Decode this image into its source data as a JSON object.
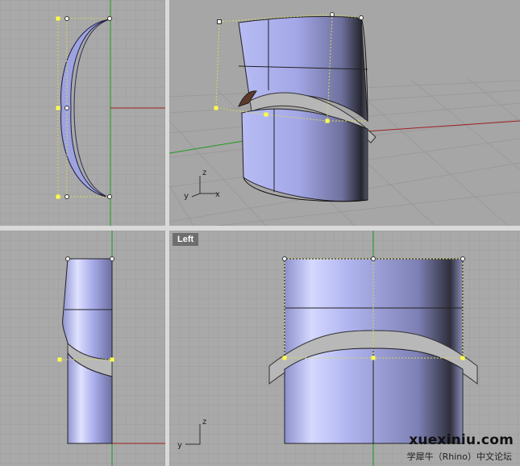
{
  "viewports": {
    "top_left": {
      "label": ""
    },
    "perspective": {
      "label": "",
      "axis_z": "z",
      "axis_y": "y",
      "axis_x": "x"
    },
    "bottom_left": {
      "label": ""
    },
    "left": {
      "label": "Left",
      "axis_z": "z",
      "axis_y": "y"
    }
  },
  "watermark": {
    "main": "xuexiniu.com",
    "sub": "学犀牛（Rhino）中文论坛"
  },
  "colors": {
    "viewport_bg": "#a9a9a9",
    "grid": "#9d9d9d",
    "surface": "#aeb2ee",
    "control_point": "#ffff4d",
    "axis_green": "#1d9a1d",
    "axis_red": "#a02020"
  }
}
